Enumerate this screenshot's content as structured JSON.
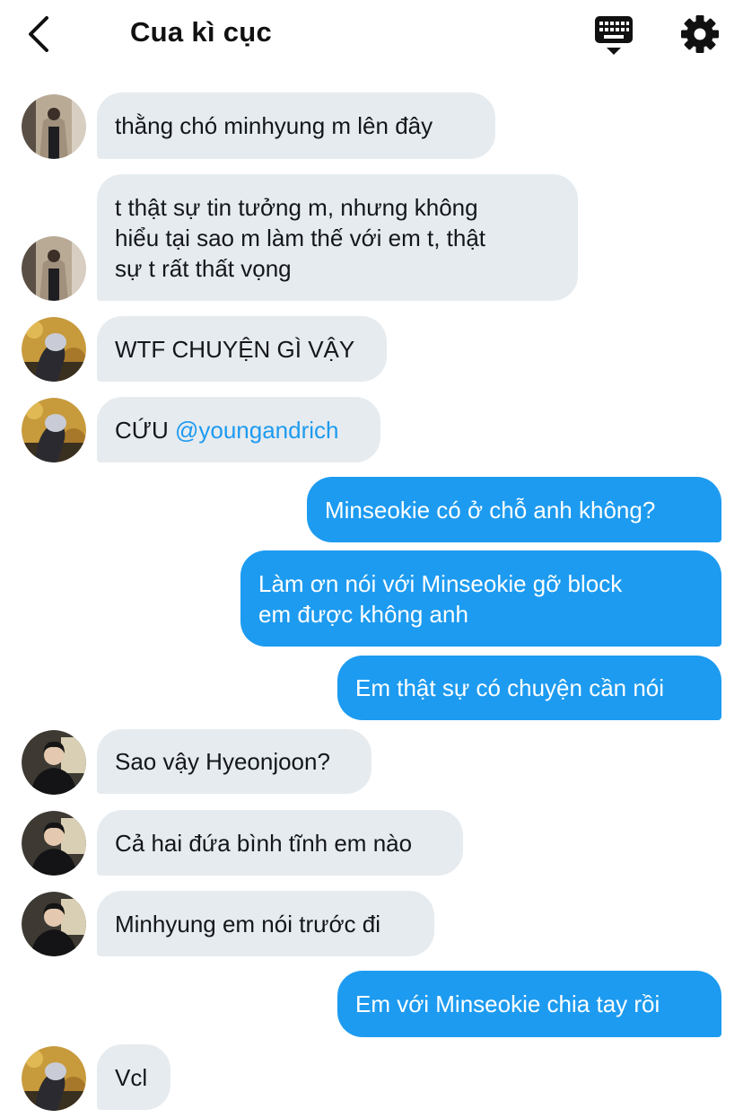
{
  "header": {
    "title": "Cua kì cục",
    "back_icon": "chevron-left-icon",
    "keyboard_icon": "keyboard-icon",
    "settings_icon": "gear-icon"
  },
  "colors": {
    "incoming_bubble": "#e6ebef",
    "outgoing_bubble": "#1d9bf0",
    "mention": "#1d9bf0"
  },
  "messages": [
    {
      "direction": "in",
      "sender_avatar": "avatar-1",
      "text": "thằng chó minhyung m lên đây"
    },
    {
      "direction": "in",
      "sender_avatar": "avatar-1",
      "lines": [
        "t thật sự tin tưởng m, nhưng không",
        "hiểu tại sao m làm thế với em t, thật",
        "sự t rất thất vọng"
      ]
    },
    {
      "direction": "in",
      "sender_avatar": "avatar-2",
      "text": "WTF CHUYỆN GÌ VẬY"
    },
    {
      "direction": "in",
      "sender_avatar": "avatar-2",
      "text": "CỨU ",
      "mention": "@youngandrich"
    },
    {
      "direction": "out",
      "text": "Minseokie có ở chỗ anh không?"
    },
    {
      "direction": "out",
      "lines": [
        "Làm ơn nói với Minseokie gỡ block",
        "em được không anh"
      ]
    },
    {
      "direction": "out",
      "text": "Em thật sự có chuyện cần nói"
    },
    {
      "direction": "in",
      "sender_avatar": "avatar-3",
      "text": "Sao vậy Hyeonjoon?"
    },
    {
      "direction": "in",
      "sender_avatar": "avatar-3",
      "text": "Cả hai đứa bình tĩnh em nào"
    },
    {
      "direction": "in",
      "sender_avatar": "avatar-3",
      "text": "Minhyung em nói trước đi"
    },
    {
      "direction": "out",
      "text": "Em với Minseokie chia tay rồi"
    },
    {
      "direction": "in",
      "sender_avatar": "avatar-2",
      "text": "Vcl"
    }
  ]
}
